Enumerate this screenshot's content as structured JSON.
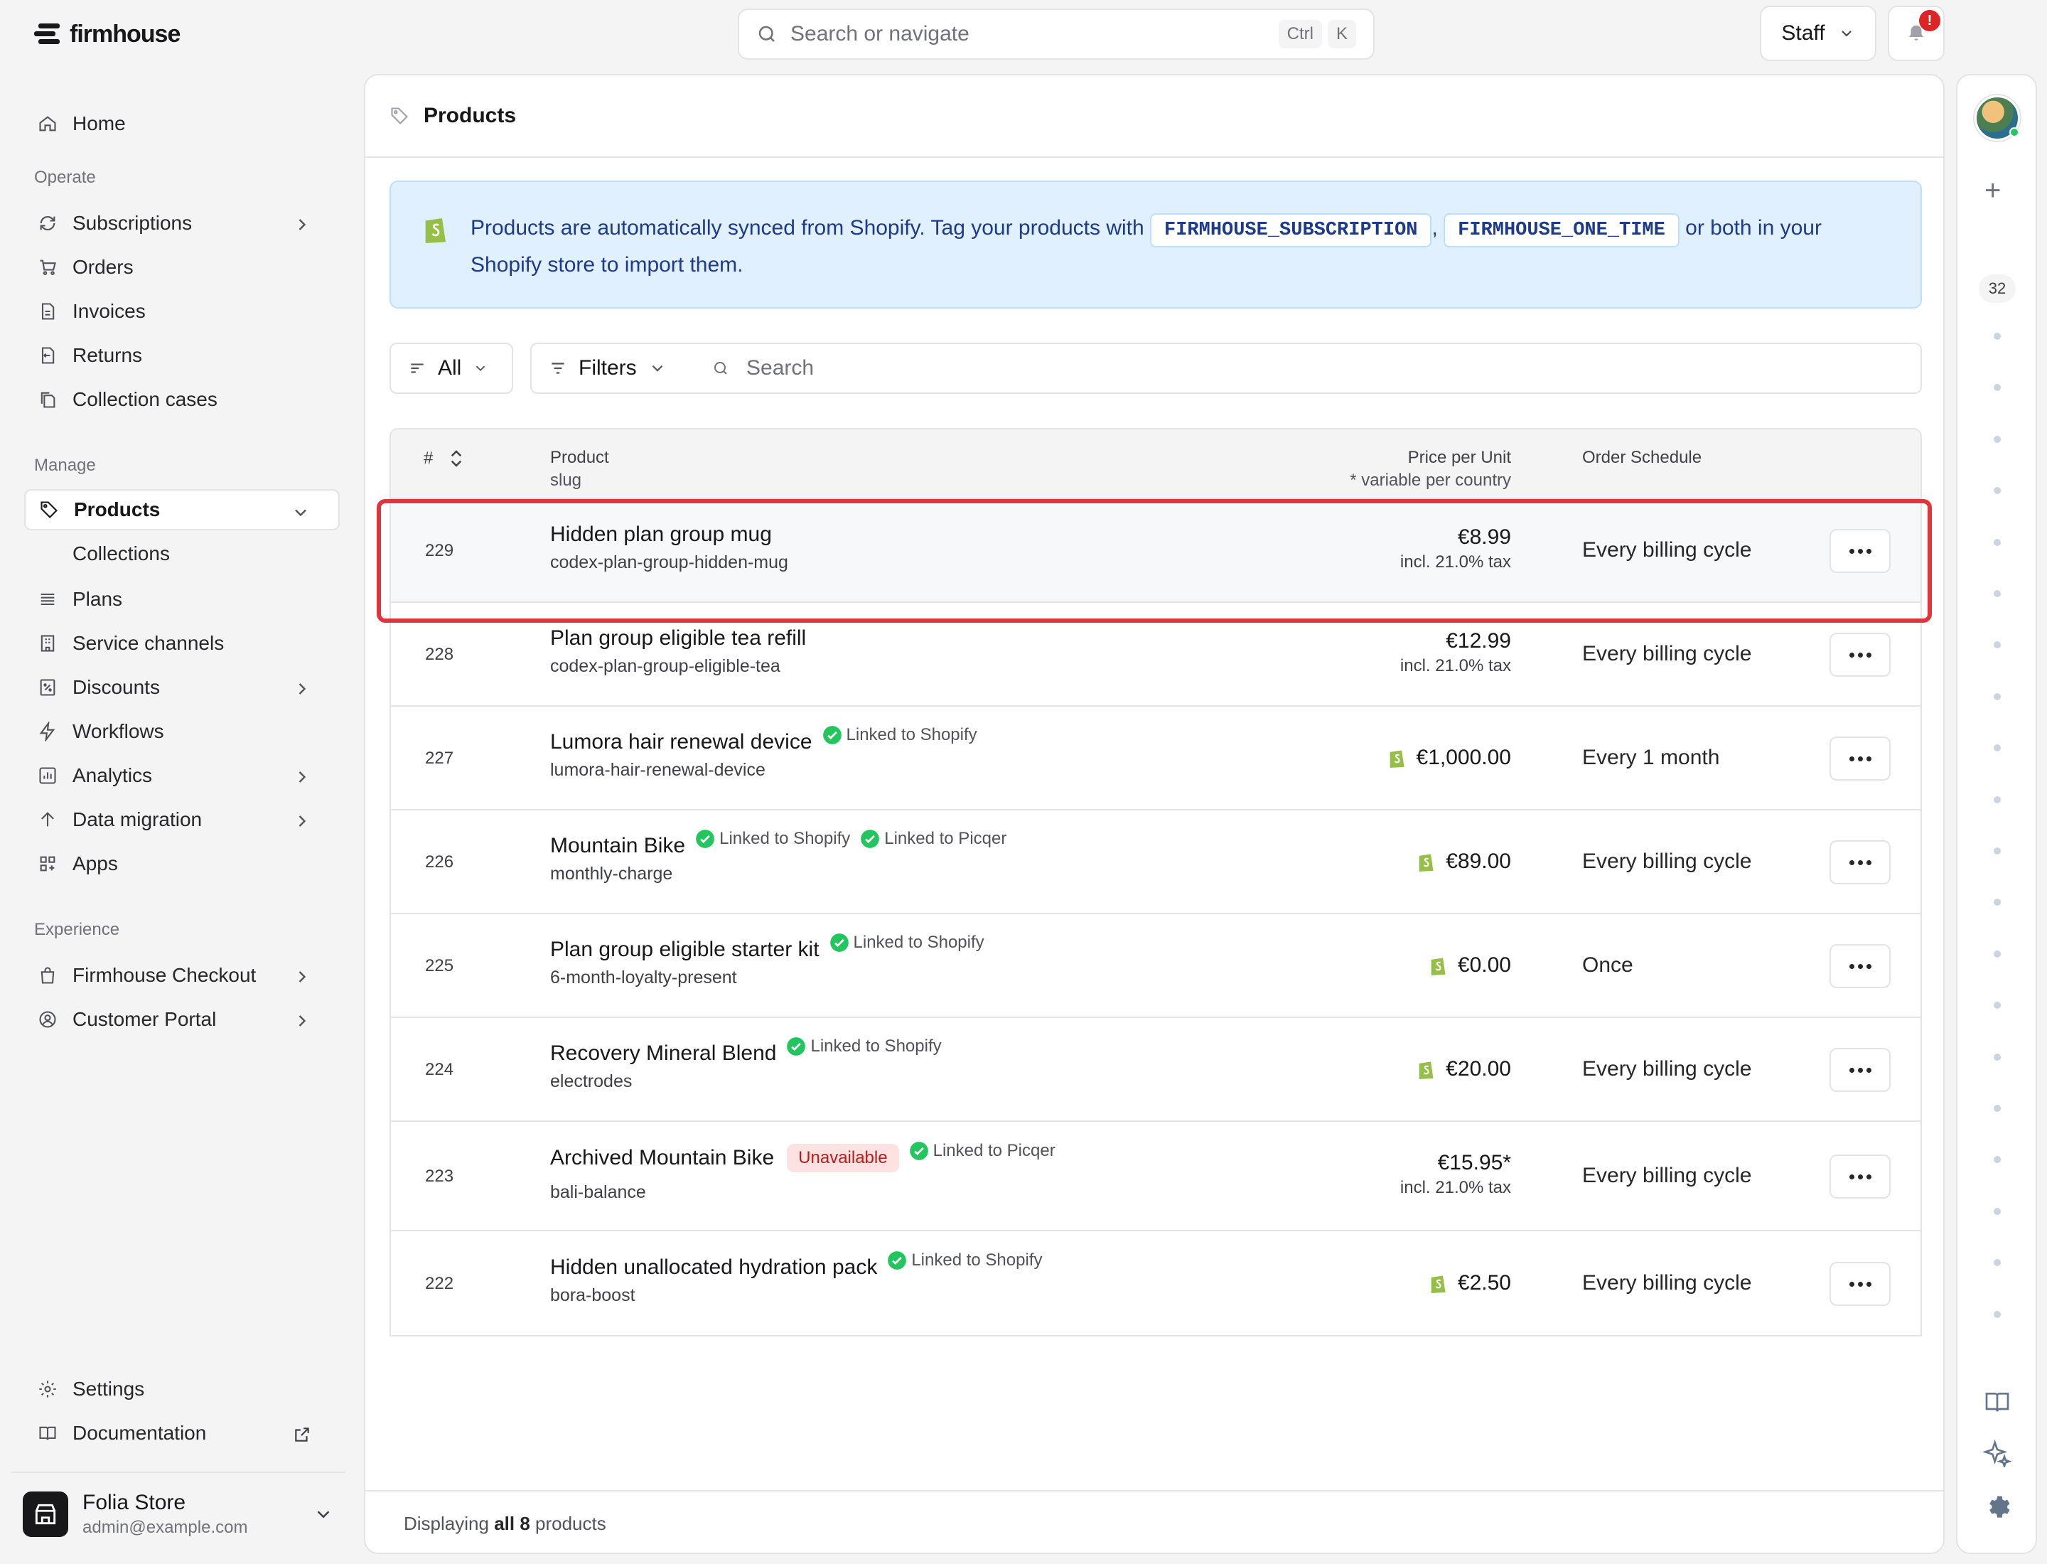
{
  "app": {
    "name": "firmhouse"
  },
  "topbar": {
    "search_placeholder": "Search or navigate",
    "shortcut_mod": "Ctrl",
    "shortcut_key": "K",
    "role_label": "Staff",
    "notification_badge": "!"
  },
  "sidebar": {
    "home": "Home",
    "sections": {
      "operate": "Operate",
      "manage": "Manage",
      "experience": "Experience"
    },
    "operate_items": [
      "Subscriptions",
      "Orders",
      "Invoices",
      "Returns",
      "Collection cases"
    ],
    "manage_items": [
      "Products",
      "Collections",
      "Plans",
      "Service channels",
      "Discounts",
      "Workflows",
      "Analytics",
      "Data migration",
      "Apps"
    ],
    "experience_items": [
      "Firmhouse Checkout",
      "Customer Portal"
    ],
    "settings": "Settings",
    "documentation": "Documentation",
    "store": {
      "name": "Folia Store",
      "email": "admin@example.com"
    }
  },
  "page": {
    "title": "Products",
    "banner": {
      "text_before": "Products are automatically synced from Shopify. Tag your products with",
      "tag1": "FIRMHOUSE_SUBSCRIPTION",
      "comma": ",",
      "tag2": "FIRMHOUSE_ONE_TIME",
      "text_after": "or both in your Shopify store to import them."
    },
    "toolbar": {
      "view_label": "All",
      "filters_label": "Filters",
      "search_placeholder": "Search"
    },
    "table": {
      "headers": {
        "id": "#",
        "product": "Product",
        "product_sub": "slug",
        "price": "Price per Unit",
        "price_sub": "* variable per country",
        "schedule": "Order Schedule"
      },
      "rows": [
        {
          "id": "229",
          "name": "Hidden plan group mug",
          "slug": "codex-plan-group-hidden-mug",
          "price": "€8.99",
          "tax": "incl. 21.0% tax",
          "schedule": "Every billing cycle"
        },
        {
          "id": "228",
          "name": "Plan group eligible tea refill",
          "slug": "codex-plan-group-eligible-tea",
          "price": "€12.99",
          "tax": "incl. 21.0% tax",
          "schedule": "Every billing cycle"
        },
        {
          "id": "227",
          "name": "Lumora hair renewal device",
          "slug": "lumora-hair-renewal-device",
          "price": "€1,000.00",
          "schedule": "Every 1 month",
          "links": [
            "Linked to Shopify"
          ]
        },
        {
          "id": "226",
          "name": "Mountain Bike",
          "slug": "monthly-charge",
          "price": "€89.00",
          "schedule": "Every billing cycle",
          "links": [
            "Linked to Shopify",
            "Linked to Picqer"
          ]
        },
        {
          "id": "225",
          "name": "Plan group eligible starter kit",
          "slug": "6-month-loyalty-present",
          "price": "€0.00",
          "schedule": "Once",
          "links": [
            "Linked to Shopify"
          ]
        },
        {
          "id": "224",
          "name": "Recovery Mineral Blend",
          "slug": "electrodes",
          "price": "€20.00",
          "schedule": "Every billing cycle",
          "links": [
            "Linked to Shopify"
          ]
        },
        {
          "id": "223",
          "name": "Archived Mountain Bike",
          "slug": "bali-balance",
          "price": "€15.95*",
          "tax": "incl. 21.0% tax",
          "schedule": "Every billing cycle",
          "badge": "Unavailable",
          "links": [
            "Linked to Picqer"
          ]
        },
        {
          "id": "222",
          "name": "Hidden unallocated hydration pack",
          "slug": "bora-boost",
          "price": "€2.50",
          "schedule": "Every billing cycle",
          "links": [
            "Linked to Shopify"
          ]
        }
      ]
    },
    "footer": {
      "prefix": "Displaying",
      "count": "all 8",
      "suffix": "products"
    }
  },
  "rail": {
    "count": "32"
  },
  "colors": {
    "accent_highlight": "#e0353d",
    "shopify_green": "#95bf47",
    "linked_green": "#22c55e"
  }
}
